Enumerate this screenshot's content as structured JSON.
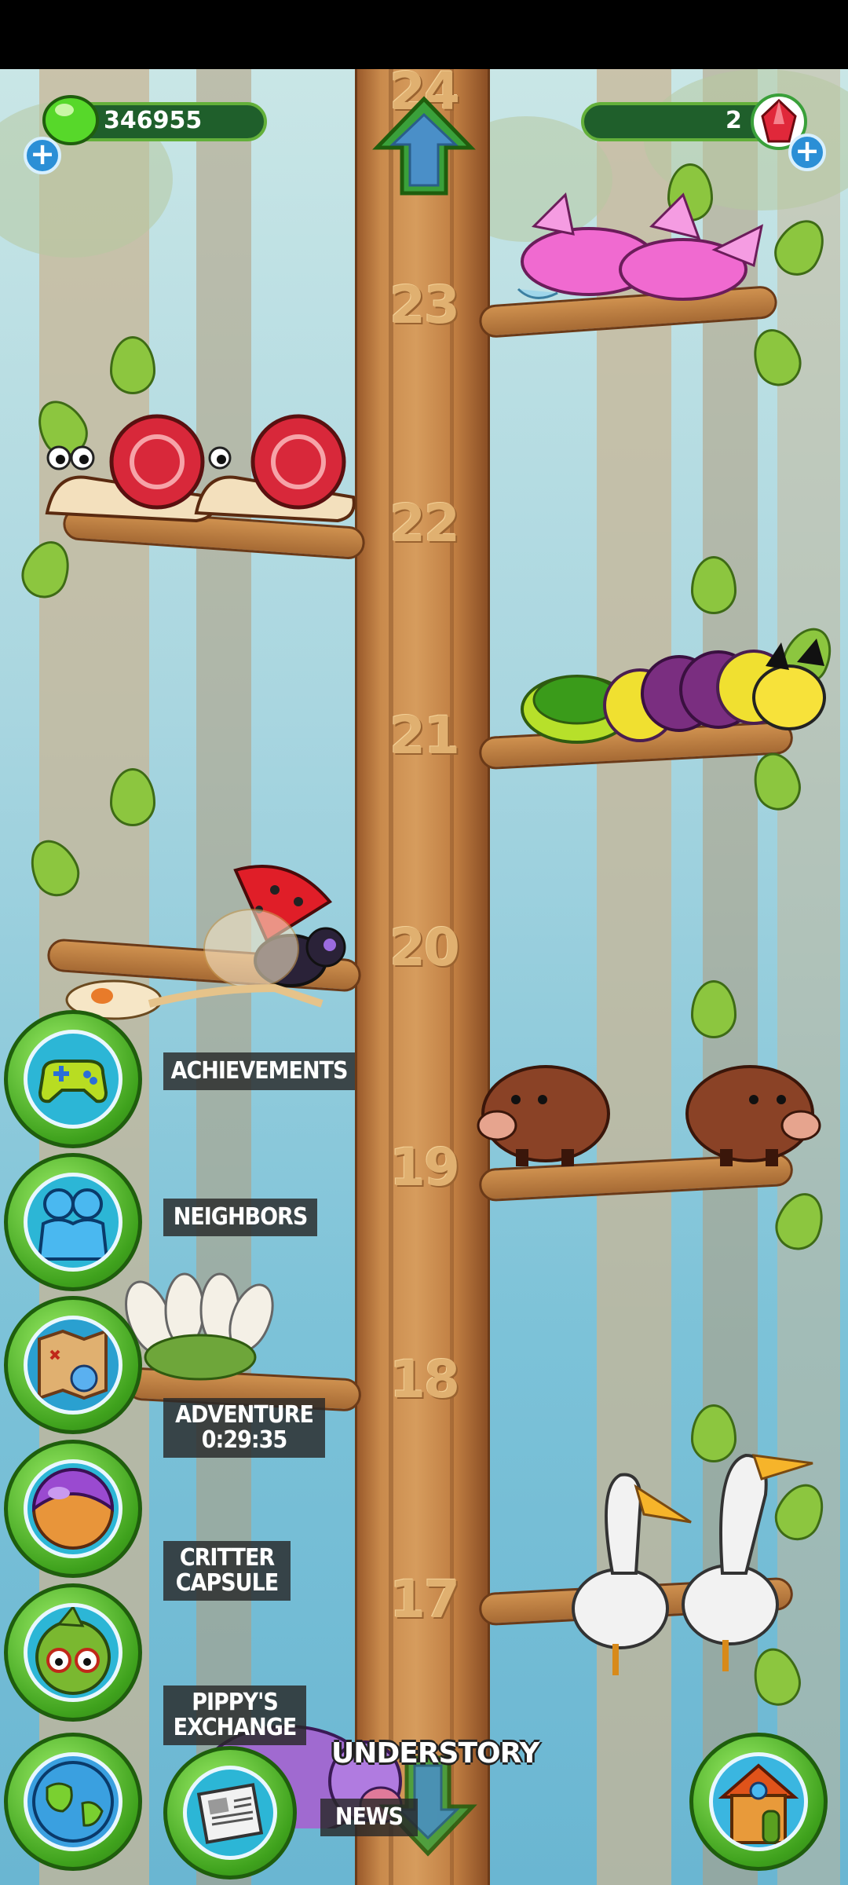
{
  "hud": {
    "currency_value": "346955",
    "currency_icon": "green-gem-icon",
    "premium_value": "2",
    "premium_icon": "red-crystal-icon",
    "add_label": "+"
  },
  "tree": {
    "floors": [
      "24",
      "23",
      "22",
      "21",
      "20",
      "19",
      "18",
      "17"
    ],
    "current_area": "UNDERSTORY",
    "critters": {
      "floor_23": "pink-axolotl-pair",
      "floor_22": "red-shell-snail-pair",
      "floor_21": "turtle-and-caterpillar",
      "floor_20": "ladybug-and-koi",
      "floor_19": "brown-boar-pair",
      "floor_18": "white-flower-critter",
      "floor_17": "pelican-pair",
      "bottom": "purple-hippo"
    }
  },
  "menu": {
    "achievements": "ACHIEVEMENTS",
    "neighbors": "NEIGHBORS",
    "adventure_title": "ADVENTURE",
    "adventure_timer": "0:29:35",
    "critter_capsule_line1": "CRITTER",
    "critter_capsule_line2": "CAPSULE",
    "pippys_exchange_line1": "PIPPY'S",
    "pippys_exchange_line2": "EXCHANGE",
    "news": "NEWS"
  },
  "colors": {
    "hud_bar": "#1f5f2b",
    "menu_green": "#3fa21d",
    "trunk": "#c98a4c"
  }
}
